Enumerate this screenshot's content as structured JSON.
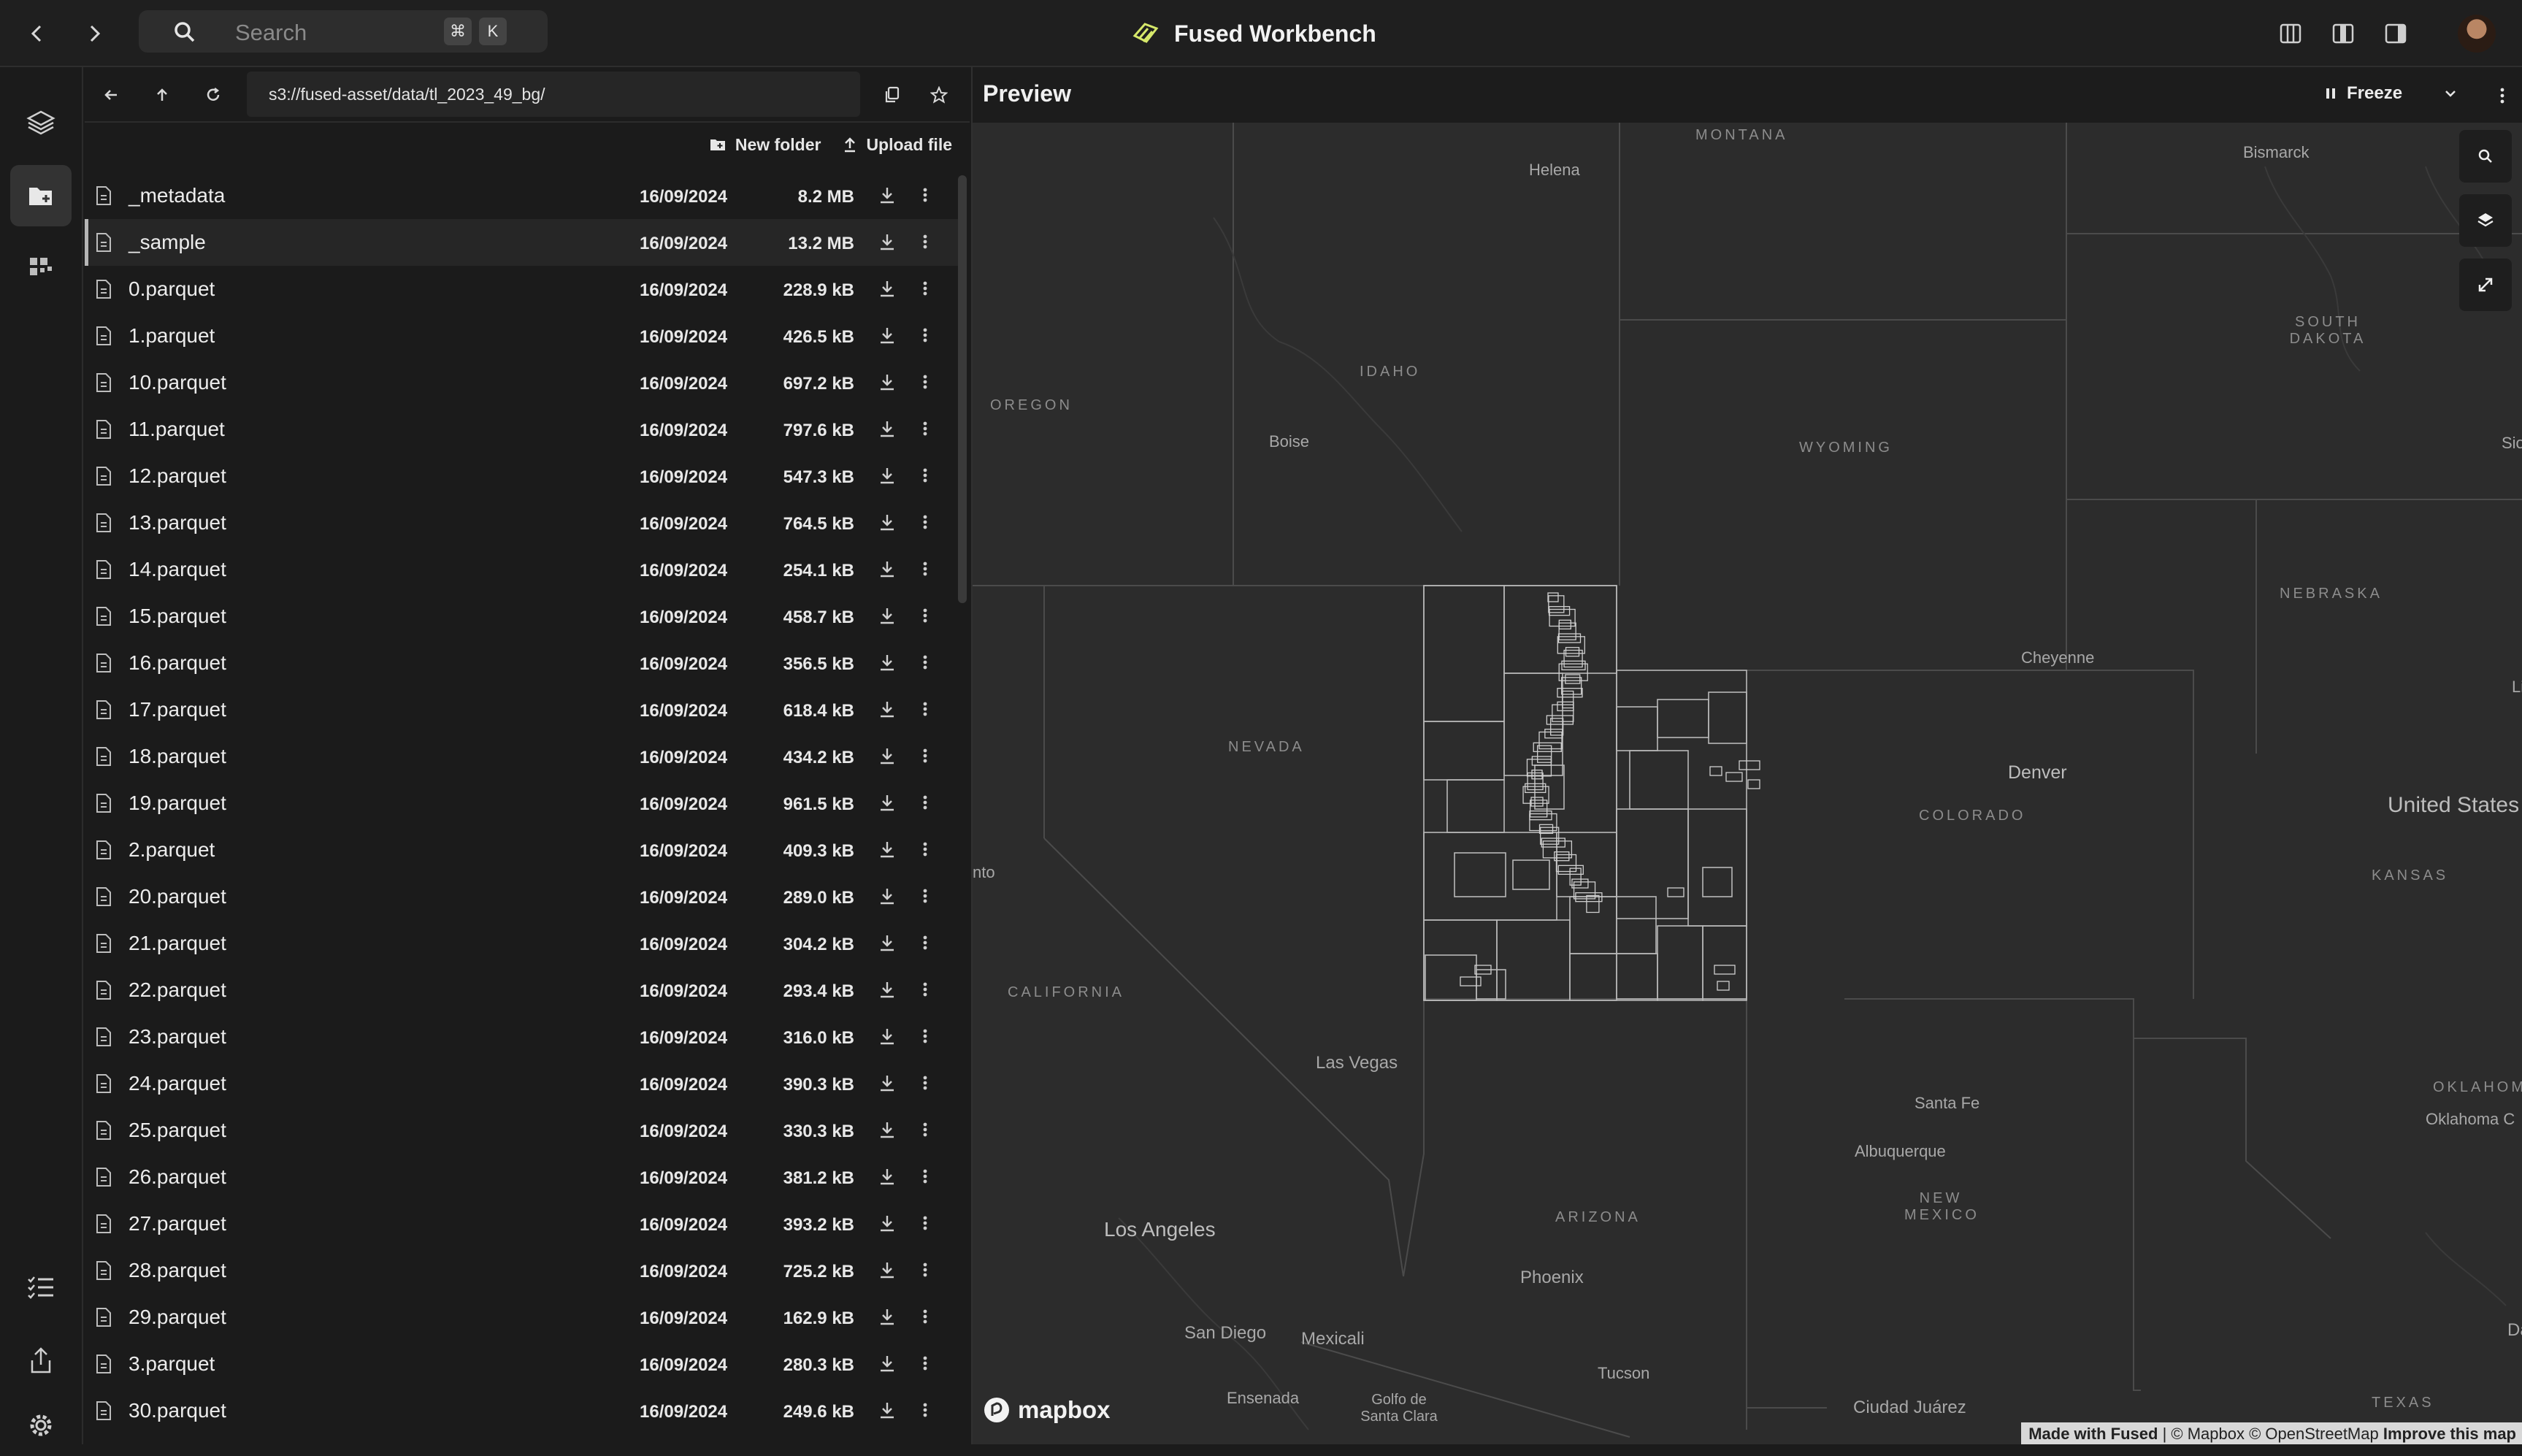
{
  "topbar": {
    "back_icon": "chevron-left-icon",
    "forward_icon": "chevron-right-icon",
    "search_placeholder": "Search",
    "shortcut_keys": [
      "⌘",
      "K"
    ],
    "app_title": "Fused Workbench",
    "layout_icons": [
      "layout-split-icon",
      "layout-left-icon",
      "layout-right-icon"
    ]
  },
  "rail": {
    "items": [
      "layers-icon",
      "file-explorer-icon",
      "widgets-icon",
      "checklist-icon",
      "share-icon",
      "settings-icon"
    ],
    "active": "file-explorer-icon"
  },
  "file_browser": {
    "path": "s3://fused-asset/data/tl_2023_49_bg/",
    "actions": {
      "new_folder": "New folder",
      "upload_file": "Upload file"
    },
    "files": [
      {
        "name": "_metadata",
        "date": "16/09/2024",
        "size": "8.2 MB"
      },
      {
        "name": "_sample",
        "date": "16/09/2024",
        "size": "13.2 MB"
      },
      {
        "name": "0.parquet",
        "date": "16/09/2024",
        "size": "228.9 kB"
      },
      {
        "name": "1.parquet",
        "date": "16/09/2024",
        "size": "426.5 kB"
      },
      {
        "name": "10.parquet",
        "date": "16/09/2024",
        "size": "697.2 kB"
      },
      {
        "name": "11.parquet",
        "date": "16/09/2024",
        "size": "797.6 kB"
      },
      {
        "name": "12.parquet",
        "date": "16/09/2024",
        "size": "547.3 kB"
      },
      {
        "name": "13.parquet",
        "date": "16/09/2024",
        "size": "764.5 kB"
      },
      {
        "name": "14.parquet",
        "date": "16/09/2024",
        "size": "254.1 kB"
      },
      {
        "name": "15.parquet",
        "date": "16/09/2024",
        "size": "458.7 kB"
      },
      {
        "name": "16.parquet",
        "date": "16/09/2024",
        "size": "356.5 kB"
      },
      {
        "name": "17.parquet",
        "date": "16/09/2024",
        "size": "618.4 kB"
      },
      {
        "name": "18.parquet",
        "date": "16/09/2024",
        "size": "434.2 kB"
      },
      {
        "name": "19.parquet",
        "date": "16/09/2024",
        "size": "961.5 kB"
      },
      {
        "name": "2.parquet",
        "date": "16/09/2024",
        "size": "409.3 kB"
      },
      {
        "name": "20.parquet",
        "date": "16/09/2024",
        "size": "289.0 kB"
      },
      {
        "name": "21.parquet",
        "date": "16/09/2024",
        "size": "304.2 kB"
      },
      {
        "name": "22.parquet",
        "date": "16/09/2024",
        "size": "293.4 kB"
      },
      {
        "name": "23.parquet",
        "date": "16/09/2024",
        "size": "316.0 kB"
      },
      {
        "name": "24.parquet",
        "date": "16/09/2024",
        "size": "390.3 kB"
      },
      {
        "name": "25.parquet",
        "date": "16/09/2024",
        "size": "330.3 kB"
      },
      {
        "name": "26.parquet",
        "date": "16/09/2024",
        "size": "381.2 kB"
      },
      {
        "name": "27.parquet",
        "date": "16/09/2024",
        "size": "393.2 kB"
      },
      {
        "name": "28.parquet",
        "date": "16/09/2024",
        "size": "725.2 kB"
      },
      {
        "name": "29.parquet",
        "date": "16/09/2024",
        "size": "162.9 kB"
      },
      {
        "name": "3.parquet",
        "date": "16/09/2024",
        "size": "280.3 kB"
      },
      {
        "name": "30.parquet",
        "date": "16/09/2024",
        "size": "249.6 kB"
      }
    ],
    "selected": "_sample"
  },
  "preview": {
    "title": "Preview",
    "freeze_label": "Freeze",
    "map_controls": [
      "search-icon",
      "layers-icon",
      "fullscreen-icon"
    ],
    "labels": {
      "montana": "MONTANA",
      "helena": "Helena",
      "bismarck": "Bismarck",
      "south_dakota": "SOUTH DAKOTA",
      "idaho": "IDAHO",
      "oregon": "OREGON",
      "boise": "Boise",
      "wyoming": "WYOMING",
      "nebraska": "NEBRASKA",
      "cheyenne": "Cheyenne",
      "nevada": "NEVADA",
      "denver": "Denver",
      "colorado": "COLORADO",
      "united_states": "United States",
      "kansas": "KANSAS",
      "sacramento_fragment": "nto",
      "california": "CALIFORNIA",
      "las_vegas": "Las Vegas",
      "santa_fe": "Santa Fe",
      "albuquerque": "Albuquerque",
      "new_mexico": "NEW MEXICO",
      "oklahoma": "OKLAHOM",
      "oklahoma_city": "Oklahoma C",
      "los_angeles": "Los Angeles",
      "arizona": "ARIZONA",
      "phoenix": "Phoenix",
      "san_diego": "San Diego",
      "mexicali": "Mexicali",
      "tucson": "Tucson",
      "ensenada": "Ensenada",
      "golfo": "Golfo de Santa Clara",
      "ciudad_juarez": "Ciudad Juárez",
      "texas": "TEXAS",
      "sioux_fragment": "Sio",
      "lincoln_fragment": "Li",
      "da_fragment": "Da"
    },
    "mapbox_text": "mapbox",
    "attribution": {
      "made_with": "Made with Fused",
      "rest": " | © Mapbox © OpenStreetMap ",
      "improve": "Improve this map"
    }
  }
}
